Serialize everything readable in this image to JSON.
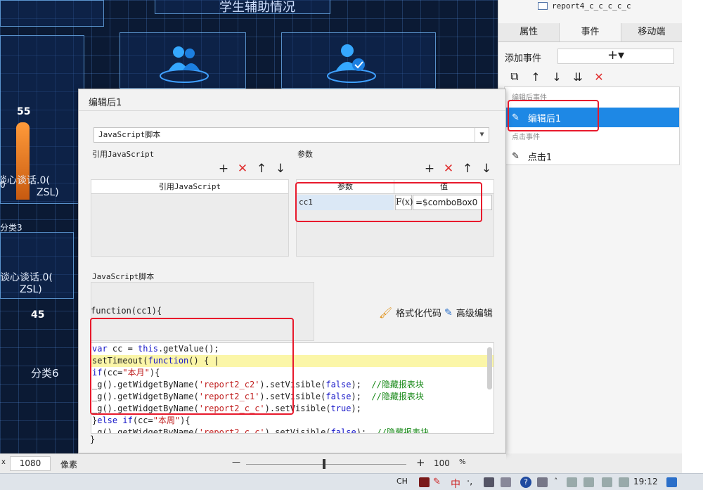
{
  "dashboard": {
    "title": "学生辅助情况",
    "numbers": [
      "55",
      "45"
    ],
    "labels": [
      "谈心谈话.0(",
      "ZSL)",
      "分类3",
      "谈心谈话.0(",
      "ZSL)",
      "分类6"
    ],
    "left_num": "0",
    "bar_color": "#f08a2a"
  },
  "right_panel": {
    "tree_item": "report4_c_c_c_c_c",
    "tabs": [
      "属性",
      "事件",
      "移动端"
    ],
    "active_tab": "事件",
    "add_event_label": "添加事件",
    "add_event_button": "+▾",
    "toolbar_icons": [
      "copy-icon",
      "arrow-up-icon",
      "arrow-down-icon",
      "move-bottom-icon",
      "delete-icon"
    ],
    "groups": [
      {
        "label": "编辑后事件",
        "items": [
          {
            "label": "编辑后1",
            "selected": true
          }
        ]
      },
      {
        "label": "点击事件",
        "items": [
          {
            "label": "点击1",
            "selected": false
          }
        ]
      }
    ]
  },
  "dialog": {
    "title": "编辑后1",
    "script_type": "JavaScript脚本",
    "ref_js": {
      "section_label": "引用JavaScript",
      "column": "引用JavaScript"
    },
    "params": {
      "section_label": "参数",
      "columns": [
        "参数",
        "值"
      ],
      "rows": [
        {
          "name": "cc1",
          "fx": "F(x)",
          "value": "=$comboBox0"
        }
      ]
    },
    "script_section_label": "JavaScript脚本",
    "function_header": "function(cc1){",
    "format_code": "格式化代码",
    "advanced_edit": "高级编辑",
    "function_footer": "}"
  },
  "status_bar": {
    "width_value": "1080",
    "unit": "像素",
    "zoom_minus": "—",
    "zoom_plus": "+",
    "zoom_value": "100",
    "zoom_unit": "%"
  },
  "taskbar": {
    "ime": "CH",
    "ime_mode": "中",
    "clock": "19:12"
  }
}
